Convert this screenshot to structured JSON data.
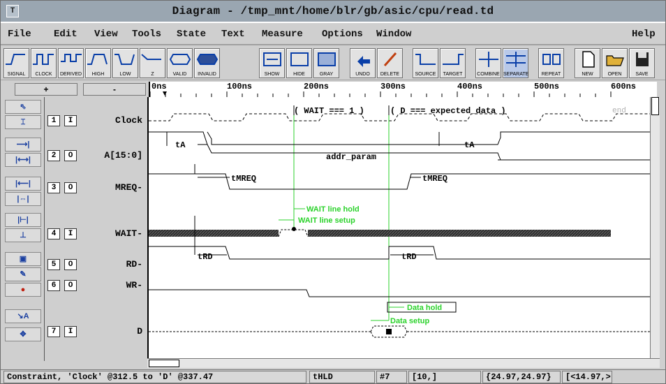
{
  "window": {
    "title": "Diagram - /tmp_mnt/home/blr/gb/asic/cpu/read.td",
    "sys_button": "T"
  },
  "menu": [
    "File",
    "Edit",
    "View",
    "Tools",
    "State",
    "Text",
    "Measure",
    "Options",
    "Window",
    "Help"
  ],
  "toolbar": [
    "SIGNAL",
    "CLOCK",
    "DERIVED",
    "HIGH",
    "LOW",
    "Z",
    "VALID",
    "INVALID",
    "SHOW",
    "HIDE",
    "GRAY",
    "UNDO",
    "DELETE",
    "SOURCE",
    "TARGET",
    "COMBINE",
    "SEPARATE",
    "REPEAT",
    "NEW",
    "OPEN",
    "SAVE"
  ],
  "zoom": {
    "in": "+",
    "out": "-"
  },
  "ruler_ticks": [
    "0ns",
    "100ns",
    "200ns",
    "300ns",
    "400ns",
    "500ns",
    "600ns"
  ],
  "tools": [
    "pointer-icon",
    "clock-edit-icon",
    "arrow-right-icon",
    "range-icon",
    "extent-icon",
    "bidirect-icon",
    "setup-icon",
    "anchor-icon",
    "paint-icon",
    "pen-icon",
    "bomb-icon",
    "text-icon",
    "move-icon"
  ],
  "signals": [
    {
      "num": "1",
      "dir": "I",
      "name": "Clock"
    },
    {
      "num": "2",
      "dir": "O",
      "name": "A[15:0]"
    },
    {
      "num": "3",
      "dir": "O",
      "name": "MREQ-"
    },
    {
      "num": "4",
      "dir": "I",
      "name": "WAIT-"
    },
    {
      "num": "5",
      "dir": "O",
      "name": "RD-"
    },
    {
      "num": "6",
      "dir": "O",
      "name": "WR-"
    },
    {
      "num": "7",
      "dir": "I",
      "name": "D"
    }
  ],
  "annotations": {
    "wait_cond": "( WAIT === 1 )",
    "d_cond": "( D === expected_data )",
    "end": "end",
    "tA1": "tA",
    "tA2": "tA",
    "addr": "addr_param",
    "tmreq1": "tMREQ",
    "tmreq2": "tMREQ",
    "wait_hold": "WAIT line hold",
    "wait_setup": "WAIT line setup",
    "trd1": "tRD",
    "trd2": "tRD",
    "data_hold": "Data hold",
    "data_setup": "Data setup"
  },
  "status": {
    "constraint": "Constraint, 'Clock' @312.5 to 'D' @337.47",
    "f1": "tHLD",
    "f2": "#7",
    "f3": "[10,]",
    "f4": "{24.97,24.97}",
    "f5": "[<14.97,>"
  },
  "colors": {
    "timing": "#000000",
    "constraint": "#2bd22b",
    "hatch": "#2d2d2d"
  }
}
